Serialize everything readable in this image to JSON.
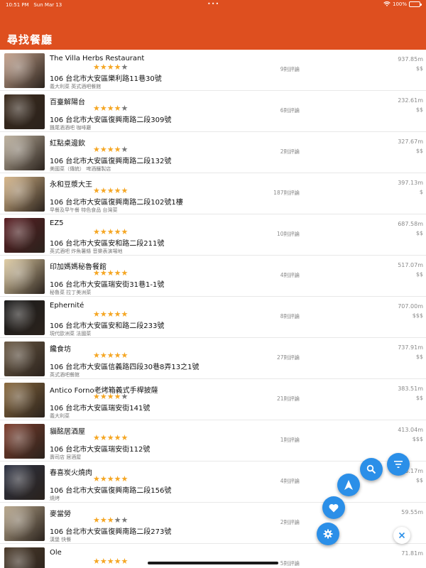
{
  "status_bar": {
    "time": "10:51 PM",
    "date": "Sun Mar 13",
    "battery": "100%",
    "battery_level": 1.0,
    "dots": "•••"
  },
  "header": {
    "title": "尋找餐廳"
  },
  "restaurants": [
    {
      "name": "The Villa Herbs Restaurant",
      "rating": 4,
      "address": "106 台北市大安區樂利路11巷30號",
      "tags": "義大利菜 英式酒吧餐館",
      "reviews": "9則評論",
      "distance": "937.85m",
      "price": "$$",
      "thumb_color": "#c7a48e"
    },
    {
      "name": "百臺解陽台",
      "rating": 4,
      "address": "106 台北市大安區復興南路二段309號",
      "tags": "雞尾酒酒吧 咖啡廳",
      "reviews": "6則評論",
      "distance": "232.61m",
      "price": "$$",
      "thumb_color": "#3a2a1c"
    },
    {
      "name": "紅點桌邊飲",
      "rating": 4,
      "address": "106 台北市大安區復興南路二段132號",
      "tags": "美國菜（傳統） 啤酒釀製店",
      "reviews": "2則評論",
      "distance": "327.67m",
      "price": "$$",
      "thumb_color": "#bfb3a0"
    },
    {
      "name": "永和豆漿大王",
      "rating": 5,
      "address": "106 台北市大安區復興南路二段102號1樓",
      "tags": "早餐及早午餐 特色食品 台灣菜",
      "reviews": "187則評論",
      "distance": "397.13m",
      "price": "$",
      "thumb_color": "#d9b88a"
    },
    {
      "name": "EZ5",
      "rating": 5,
      "address": "106 台北市大安區安和路二段211號",
      "tags": "英式酒吧 炸魚薯條 音樂表演場地",
      "reviews": "10則評論",
      "distance": "687.58m",
      "price": "$$",
      "thumb_color": "#5a1d22"
    },
    {
      "name": "印加媽媽秘魯餐館",
      "rating": 5,
      "address": "106 台北市大安區瑞安街31巷1-1號",
      "tags": "秘魯菜 拉丁美洲菜",
      "reviews": "4則評論",
      "distance": "517.07m",
      "price": "$$",
      "thumb_color": "#e2cfa6"
    },
    {
      "name": "Ephernité",
      "rating": 5,
      "address": "106 台北市大安區安和路二段233號",
      "tags": "現代歐洲菜 法國菜",
      "reviews": "8則評論",
      "distance": "707.00m",
      "price": "$$$",
      "thumb_color": "#1c1c1c"
    },
    {
      "name": "饞食坊",
      "rating": 5,
      "address": "106 台北市大安區信義路四段30巷8弄13之1號",
      "tags": "英式酒吧餐館",
      "reviews": "27則評論",
      "distance": "737.91m",
      "price": "$$",
      "thumb_color": "#6b5a45"
    },
    {
      "name": "Antico Forno老烤箱義式手桿披薩",
      "rating": 4,
      "address": "106 台北市大安區瑞安街141號",
      "tags": "義大利菜",
      "reviews": "21則評論",
      "distance": "383.51m",
      "price": "$$",
      "thumb_color": "#8a6a3e"
    },
    {
      "name": "貓酩居酒屋",
      "rating": 5,
      "address": "106 台北市大安區瑞安街112號",
      "tags": "壽司店 居酒屋",
      "reviews": "1則評論",
      "distance": "413.04m",
      "price": "$$$",
      "thumb_color": "#7d3c2b"
    },
    {
      "name": "春喜炭火燒肉",
      "rating": 5,
      "address": "106 台北市大安區復興南路二段156號",
      "tags": "燒烤",
      "reviews": "4則評論",
      "distance": "203.17m",
      "price": "$$",
      "thumb_color": "#2c3142"
    },
    {
      "name": "麥當勞",
      "rating": 3,
      "address": "106 台北市大安區復興南路二段273號",
      "tags": "漢堡 快餐",
      "reviews": "2則評論",
      "distance": "59.55m",
      "price": "",
      "thumb_color": "#b9a88d"
    },
    {
      "name": "Ole",
      "rating": 5,
      "address": "",
      "tags": "",
      "reviews": "5則評論",
      "distance": "71.81m",
      "price": "",
      "thumb_color": "#4a3a2a"
    }
  ],
  "fabs": {
    "filter": "filter-icon",
    "search": "search-icon",
    "navigate": "navigation-arrow-icon",
    "favorite": "heart-icon",
    "settings": "gear-icon",
    "close": "close-icon"
  },
  "colors": {
    "brand": "#de4f1f",
    "fab": "#2b8fe8",
    "star": "#f5a623",
    "star_empty": "#777777"
  }
}
